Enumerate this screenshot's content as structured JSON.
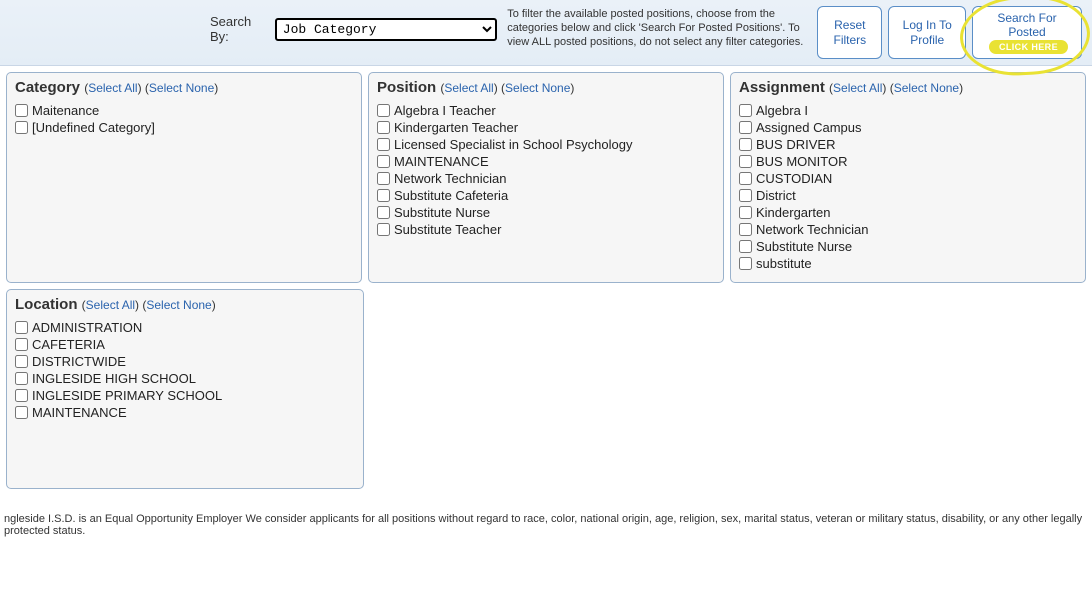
{
  "topbar": {
    "search_by_label": "Search By:",
    "search_by_value": "Job Category",
    "instructions": "To filter the available posted positions, choose from the categories below and click 'Search For Posted Positions'. To view ALL posted positions, do not select any filter categories.",
    "reset_btn": "Reset Filters",
    "login_btn": "Log In To Profile",
    "search_btn": "Search For Posted Positions",
    "click_here": "CLICK HERE"
  },
  "links": {
    "select_all": "Select All",
    "select_none": "Select None"
  },
  "panels": {
    "category": {
      "title": "Category",
      "items": [
        "Maitenance",
        "[Undefined Category]"
      ]
    },
    "position": {
      "title": "Position",
      "items": [
        "Algebra I Teacher",
        "Kindergarten Teacher",
        "Licensed Specialist in School Psychology",
        "MAINTENANCE",
        "Network Technician",
        "Substitute Cafeteria",
        "Substitute Nurse",
        "Substitute Teacher"
      ]
    },
    "assignment": {
      "title": "Assignment",
      "items": [
        "Algebra I",
        "Assigned Campus",
        "BUS DRIVER",
        "BUS MONITOR",
        "CUSTODIAN",
        "District",
        "Kindergarten",
        "Network Technician",
        "Substitute Nurse",
        "substitute"
      ]
    },
    "location": {
      "title": "Location",
      "items": [
        "ADMINISTRATION",
        "CAFETERIA",
        "DISTRICTWIDE",
        "INGLESIDE HIGH SCHOOL",
        "INGLESIDE PRIMARY SCHOOL",
        "MAINTENANCE"
      ]
    }
  },
  "footer": "ngleside I.S.D. is an Equal Opportunity Employer We consider applicants for all positions without regard to race, color, national origin, age, religion, sex, marital status, veteran or military status, disability, or any other legally protected status."
}
